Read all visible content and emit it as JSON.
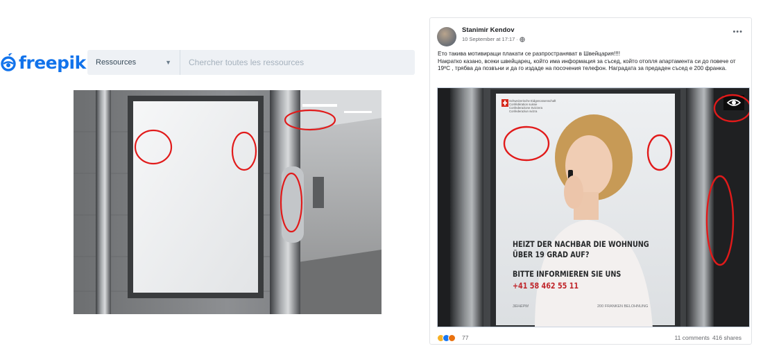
{
  "freepik": {
    "logo_text": "freepik",
    "filter_label": "Ressources",
    "search_placeholder": "Chercher toutes les ressources",
    "brand_color": "#1273eb"
  },
  "post": {
    "author": "Stanimir Kendov",
    "timestamp": "10 September at 17:17 · ",
    "body_lines": [
      "Ето такива мотивиращи плакати се разпространяват в Швейцария!!!!",
      "Накратко казано, всеки швейцарец, който има информация за съсед, който отопля апартамента си до повече от 19ºC , трябва да позвъни и да го издаде на посочения телефон. Наградата за предаден съсед е 200 франка."
    ],
    "reaction_count": "77",
    "comments": "11 comments",
    "shares": "416 shares"
  },
  "poster": {
    "authority_lines": [
      "Schweizerische Eidgenossenschaft",
      "Confédération suisse",
      "Confederazione Svizzera",
      "Confederaziun svizra"
    ],
    "headline_1": "HEIZT DER NACHBAR DIE WOHNUNG",
    "headline_2": "ÜBER 19 GRAD AUF?",
    "cta": "BITTE INFORMIEREN SIE UNS",
    "phone": "+41 58 462 55 11",
    "footer_left": "ЗЕНЕРМ",
    "footer_right": "200 FRANKEN BELOHNUNG"
  },
  "colors": {
    "annotation_red": "#e11a1a",
    "facebook_blue": "#1877f2",
    "poster_red": "#c0262b"
  }
}
